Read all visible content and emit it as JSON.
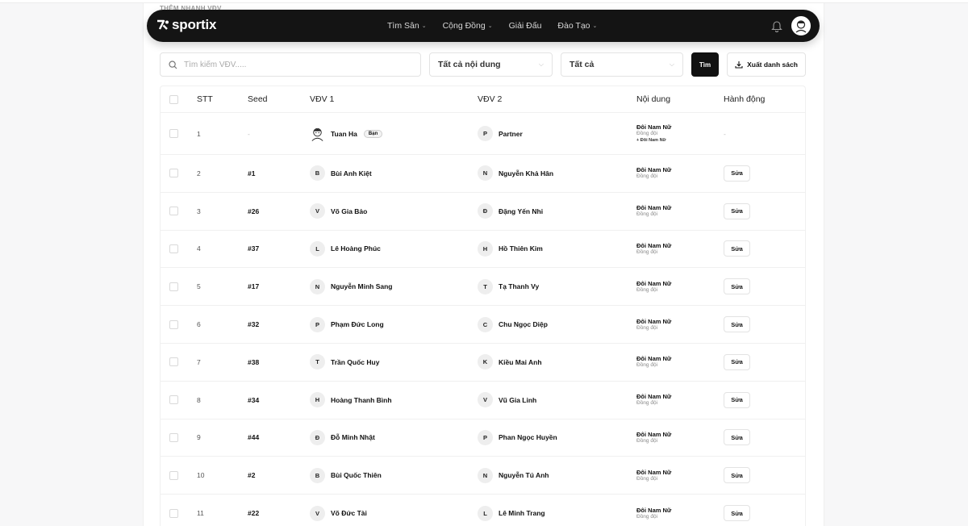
{
  "page": {
    "peek_label": "THÊM NHANH VĐV"
  },
  "navbar": {
    "logo": "sportix",
    "menu": [
      {
        "label": "Tìm Sân",
        "has_dropdown": true
      },
      {
        "label": "Cộng Đồng",
        "has_dropdown": true
      },
      {
        "label": "Giải Đấu",
        "has_dropdown": false
      },
      {
        "label": "Đào Tạo",
        "has_dropdown": true
      }
    ],
    "icons": [
      "bell-icon",
      "avatar"
    ]
  },
  "filters": {
    "search_placeholder": "Tìm kiếm VĐV.....",
    "content_select": "Tất cả nội dung",
    "status_select": "Tất cả",
    "search_button": "Tìm",
    "export_button": "Xuất danh sách"
  },
  "table": {
    "headers": {
      "stt": "STT",
      "seed": "Seed",
      "p1": "VĐV 1",
      "p2": "VĐV 2",
      "content": "Nội dung",
      "action": "Hành động"
    },
    "edit_label": "Sửa",
    "first_row": {
      "stt": "1",
      "seed": "-",
      "p1_name": "Tuan Ha",
      "p1_badge": "Bạn",
      "p2_initial": "P",
      "p2_name": "Partner",
      "content_title": "Đôi Nam Nữ",
      "content_sub": "Đồng đội",
      "content_extra": "+ Đôi Nam Nữ",
      "action": "-"
    },
    "rows": [
      {
        "stt": "2",
        "seed": "#1",
        "p1_initial": "B",
        "p1_name": "Bùi Anh Kiệt",
        "p2_initial": "N",
        "p2_name": "Nguyễn Khả Hân",
        "content_title": "Đôi Nam Nữ",
        "content_sub": "Đồng đội"
      },
      {
        "stt": "3",
        "seed": "#26",
        "p1_initial": "V",
        "p1_name": "Võ Gia Bảo",
        "p2_initial": "Đ",
        "p2_name": "Đặng Yến Nhi",
        "content_title": "Đôi Nam Nữ",
        "content_sub": "Đồng đội"
      },
      {
        "stt": "4",
        "seed": "#37",
        "p1_initial": "L",
        "p1_name": "Lê Hoàng Phúc",
        "p2_initial": "H",
        "p2_name": "Hồ Thiên Kim",
        "content_title": "Đôi Nam Nữ",
        "content_sub": "Đồng đội"
      },
      {
        "stt": "5",
        "seed": "#17",
        "p1_initial": "N",
        "p1_name": "Nguyễn Minh Sang",
        "p2_initial": "T",
        "p2_name": "Tạ Thanh Vy",
        "content_title": "Đôi Nam Nữ",
        "content_sub": "Đồng đội"
      },
      {
        "stt": "6",
        "seed": "#32",
        "p1_initial": "P",
        "p1_name": "Phạm Đức Long",
        "p2_initial": "C",
        "p2_name": "Chu Ngọc Diệp",
        "content_title": "Đôi Nam Nữ",
        "content_sub": "Đồng đội"
      },
      {
        "stt": "7",
        "seed": "#38",
        "p1_initial": "T",
        "p1_name": "Trần Quốc Huy",
        "p2_initial": "K",
        "p2_name": "Kiều Mai Anh",
        "content_title": "Đôi Nam Nữ",
        "content_sub": "Đồng đội"
      },
      {
        "stt": "8",
        "seed": "#34",
        "p1_initial": "H",
        "p1_name": "Hoàng Thanh Bình",
        "p2_initial": "V",
        "p2_name": "Vũ Gia Linh",
        "content_title": "Đôi Nam Nữ",
        "content_sub": "Đồng đội"
      },
      {
        "stt": "9",
        "seed": "#44",
        "p1_initial": "Đ",
        "p1_name": "Đỗ Minh Nhật",
        "p2_initial": "P",
        "p2_name": "Phan Ngọc Huyền",
        "content_title": "Đôi Nam Nữ",
        "content_sub": "Đồng đội"
      },
      {
        "stt": "10",
        "seed": "#2",
        "p1_initial": "B",
        "p1_name": "Bùi Quốc Thiên",
        "p2_initial": "N",
        "p2_name": "Nguyễn Tú Anh",
        "content_title": "Đôi Nam Nữ",
        "content_sub": "Đồng đội"
      },
      {
        "stt": "11",
        "seed": "#22",
        "p1_initial": "V",
        "p1_name": "Võ Đức Tài",
        "p2_initial": "L",
        "p2_name": "Lê Minh Trang",
        "content_title": "Đôi Nam Nữ",
        "content_sub": "Đồng đội"
      }
    ]
  }
}
